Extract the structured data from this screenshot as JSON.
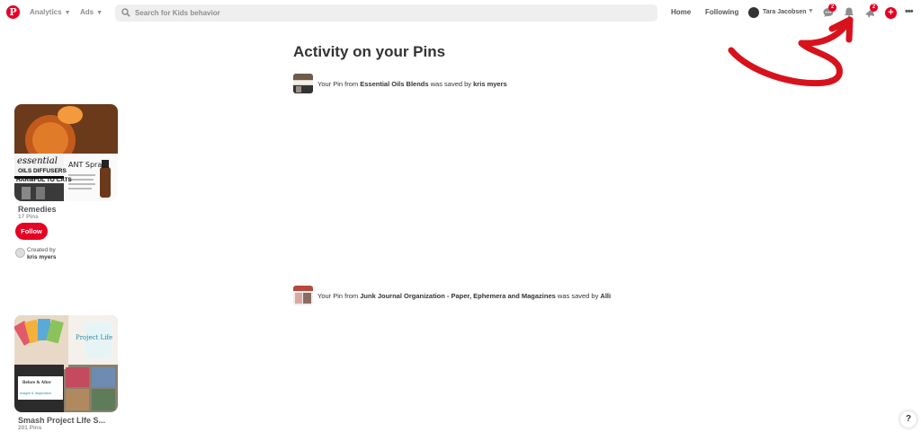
{
  "header": {
    "logo_letter": "P",
    "analytics_label": "Analytics",
    "ads_label": "Ads",
    "search_placeholder": "Search for Kids behavior",
    "home_label": "Home",
    "following_label": "Following",
    "user_name": "Tara Jacobsen",
    "messages_badge": "2",
    "notifications_badge": "2",
    "plus_label": "+",
    "more_label": "•••"
  },
  "page": {
    "title": "Activity on your Pins"
  },
  "activity": [
    {
      "prefix": "Your Pin from ",
      "board": "Essential Oils Blends",
      "middle": " was saved by ",
      "user": "kris myers"
    },
    {
      "prefix": "Your Pin from ",
      "board": "Junk Journal Organization - Paper, Ephemera and Magazines",
      "middle": " was saved by ",
      "user": "Alli"
    }
  ],
  "boards": [
    {
      "name": "Remedies",
      "pins": "17 Pins",
      "cover_text_1": "OILS DIFFUSERS",
      "cover_text_2": "HARMFUL TO CATS",
      "cover_text_3": "ANT Spray",
      "follow_label": "Follow",
      "created_by_label": "Created by",
      "creator": "kris myers"
    },
    {
      "name": "Smash Project LIfe S...",
      "pins": "201 Pins",
      "cover_text_1": "Project Life",
      "cover_text_2": "Before & After",
      "cover_text_3": "Insight & Inspiration"
    }
  ],
  "help_label": "?",
  "colors": {
    "brand_red": "#e60023",
    "search_bg": "#efefef"
  }
}
